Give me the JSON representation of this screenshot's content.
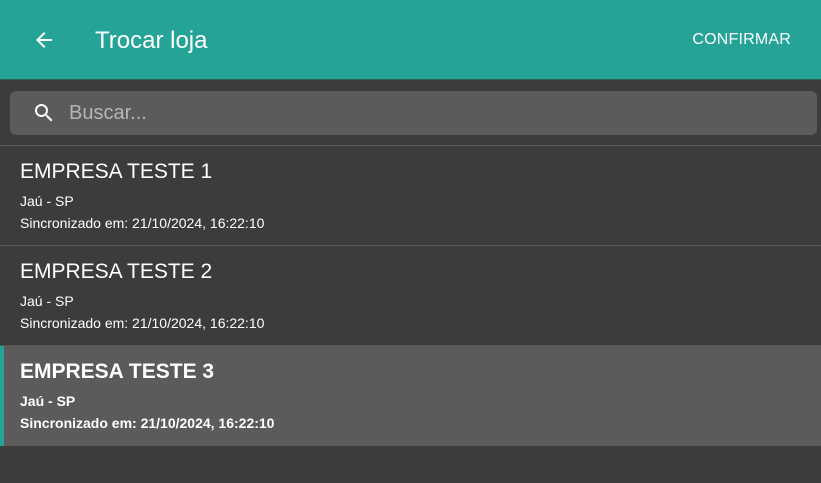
{
  "header": {
    "title": "Trocar loja",
    "confirm_label": "CONFIRMAR",
    "back_icon": "arrow-left-icon"
  },
  "search": {
    "placeholder": "Buscar...",
    "value": "",
    "icon": "search-icon"
  },
  "stores": [
    {
      "name": "EMPRESA TESTE 1",
      "city": "Jaú - SP",
      "sync": "Sincronizado em: 21/10/2024, 16:22:10",
      "selected": false
    },
    {
      "name": "EMPRESA TESTE 2",
      "city": "Jaú - SP",
      "sync": "Sincronizado em: 21/10/2024, 16:22:10",
      "selected": false
    },
    {
      "name": "EMPRESA TESTE 3",
      "city": "Jaú - SP",
      "sync": "Sincronizado em: 21/10/2024, 16:22:10",
      "selected": true
    }
  ],
  "colors": {
    "accent": "#26a397",
    "background": "#3c3c3c",
    "surface": "#5b5b5b",
    "divider": "#575757",
    "text": "#ffffff"
  }
}
